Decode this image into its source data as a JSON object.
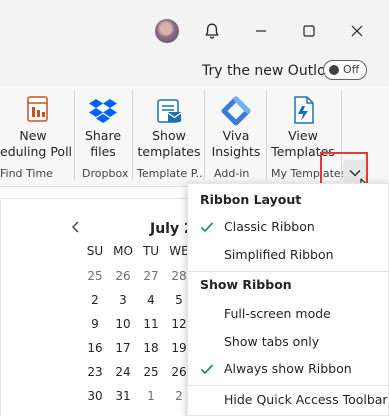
{
  "titlebar": {
    "avatar_label": "",
    "bell_icon": "bell-icon",
    "minimize_icon": "minimize-icon",
    "maximize_icon": "maximize-icon",
    "close_icon": "close-icon"
  },
  "try_new_outlook": {
    "label": "Try the new Outlook",
    "toggle_state": "Off"
  },
  "ribbon": {
    "buttons": [
      {
        "label1": "New",
        "label2": "eduling Poll",
        "icon": "scheduling-poll-icon"
      },
      {
        "label1": "Share",
        "label2": "files",
        "icon": "dropbox-icon"
      },
      {
        "label1": "Show",
        "label2": "templates",
        "icon": "templates-icon"
      },
      {
        "label1": "Viva",
        "label2": "Insights",
        "icon": "viva-insights-icon"
      },
      {
        "label1": "View",
        "label2": "Templates",
        "icon": "view-templates-icon"
      }
    ],
    "groups": [
      "Find Time",
      "Dropbox",
      "Template P...",
      "Add-in",
      "My Templates"
    ],
    "options_icon": "chevron-down-icon"
  },
  "calendar": {
    "title": "July 2",
    "prev_icon": "chevron-left-icon",
    "weekdays": [
      "SU",
      "MO",
      "TU",
      "WE"
    ],
    "weeks": [
      [
        "25",
        "26",
        "27",
        "28"
      ],
      [
        "2",
        "3",
        "4",
        "5"
      ],
      [
        "9",
        "10",
        "11",
        "12"
      ],
      [
        "16",
        "17",
        "18",
        "19"
      ],
      [
        "23",
        "24",
        "25",
        "26"
      ],
      [
        "30",
        "31",
        "1",
        "2"
      ]
    ]
  },
  "menu": {
    "layout_header": "Ribbon Layout",
    "classic": "Classic Ribbon",
    "simplified": "Simplified Ribbon",
    "show_header": "Show Ribbon",
    "fullscreen": "Full-screen mode",
    "show_tabs": "Show tabs only",
    "always_show": "Always show Ribbon",
    "hide_qat": "Hide Quick Access Toolbar",
    "checked": [
      "classic",
      "always_show"
    ],
    "accent_color": "#2e8b57"
  },
  "colors": {
    "highlight_border": "#e5383b",
    "dropbox_blue": "#0061fe",
    "office_blue": "#1c6fb5"
  }
}
